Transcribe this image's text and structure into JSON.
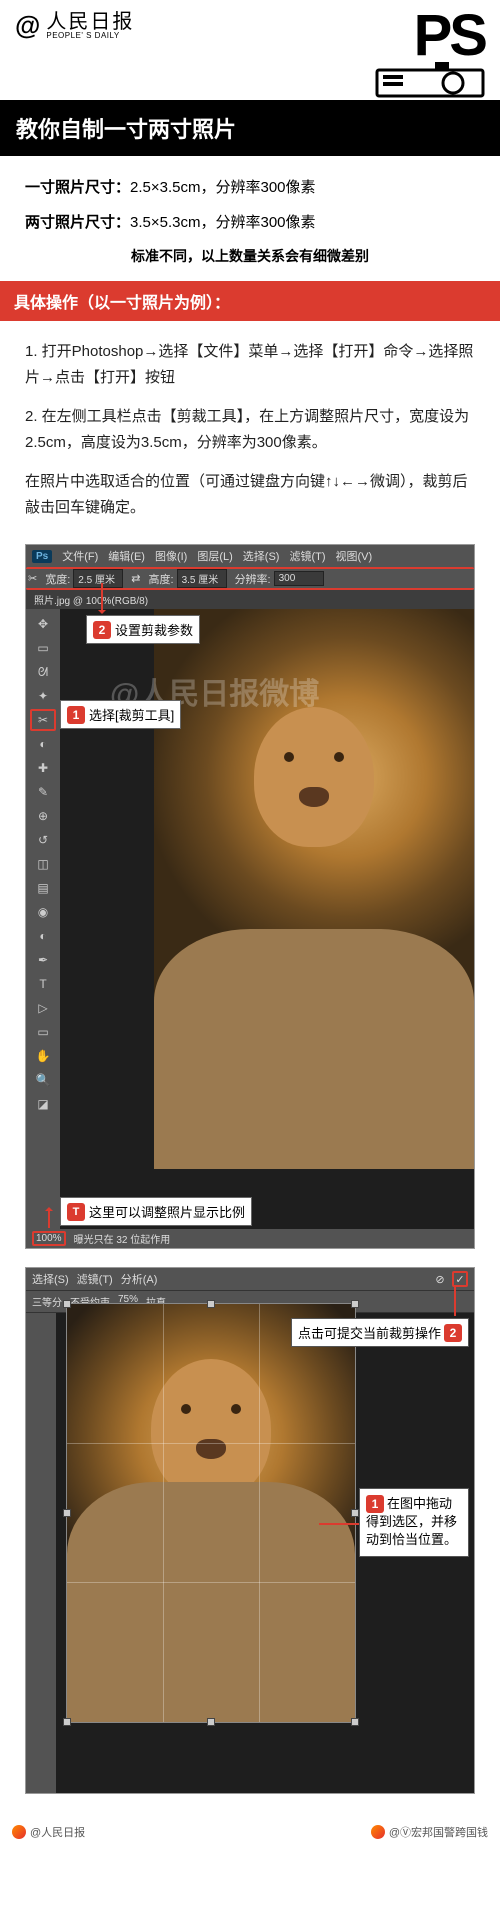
{
  "header": {
    "at": "@",
    "brand_cn": "人民日报",
    "brand_en": "PEOPLE' S DAILY",
    "ps": "PS"
  },
  "title": "教你自制一寸两寸照片",
  "info": {
    "one_inch_label": "一寸照片尺寸：",
    "one_inch_value": "2.5×3.5cm，分辨率300像素",
    "two_inch_label": "两寸照片尺寸：",
    "two_inch_value": "3.5×5.3cm，分辨率300像素",
    "note": "标准不同，以上数量关系会有细微差别"
  },
  "section_header": "具体操作（以一寸照片为例）：",
  "steps": {
    "s1": "1. 打开Photoshop→选择【文件】菜单→选择【打开】命令→选择照片→点击【打开】按钮",
    "s2": "2. 在左侧工具栏点击【剪裁工具】，在上方调整照片尺寸，宽度设为2.5cm，高度设为3.5cm，分辨率为300像素。",
    "s3": "在照片中选取适合的位置（可通过键盘方向键↑↓←→微调），裁剪后敲击回车键确定。"
  },
  "ps1": {
    "app_icon": "Ps",
    "menu": {
      "file": "文件(F)",
      "edit": "编辑(E)",
      "image": "图像(I)",
      "layer": "图层(L)",
      "select": "选择(S)",
      "filter": "滤镜(T)",
      "view": "视图(V)"
    },
    "opts": {
      "width_label": "宽度:",
      "width_val": "2.5 厘米",
      "swap": "⇄",
      "height_label": "高度:",
      "height_val": "3.5 厘米",
      "res_label": "分辨率:",
      "res_val": "300"
    },
    "doc_title": "照片.jpg @ 100%(RGB/8)",
    "callout2": "设置剪裁参数",
    "callout1": "选择[裁剪工具]",
    "calloutT": "这里可以调整照片显示比例",
    "zoom": "100%",
    "status": "曝光只在 32 位起作用",
    "watermark": "@人民日报微博"
  },
  "ps2": {
    "top_menu": {
      "select": "选择(S)",
      "filter": "滤镜(T)",
      "analysis": "分析(A)",
      "threeD": "三等分",
      "plain": "不受约束",
      "pct": "75%",
      "straighten": "拉直"
    },
    "commit_tip": "点击可提交当前裁剪操作",
    "side_tip": "在图中拖动得到选区，并移动到恰当位置。"
  },
  "footer": {
    "left": "@人民日报",
    "right": "@Ⓥ宏邦国警跨国钱"
  }
}
